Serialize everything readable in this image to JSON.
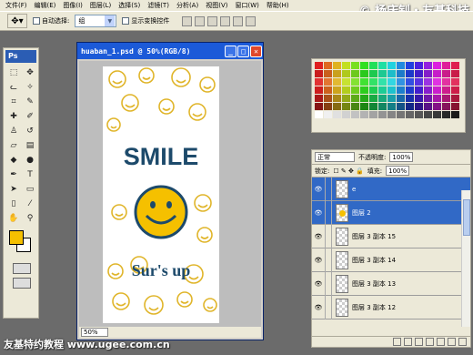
{
  "menu": [
    "文件(F)",
    "编辑(E)",
    "图像(I)",
    "图层(L)",
    "选择(S)",
    "滤镜(T)",
    "分析(A)",
    "视图(V)",
    "窗口(W)",
    "帮助(H)"
  ],
  "watermark_top": "© 杨庆钊・友基科技",
  "watermark_bottom": "友基特约教程 www.ugee.com.cn",
  "options": {
    "auto_select_label": "自动选择:",
    "auto_select_value": "组",
    "show_transform_label": "显示变换控件"
  },
  "document": {
    "title": "huaban_1.psd @ 50%(RGB/8)",
    "zoom": "50%",
    "artwork_text_1": "SMILE",
    "artwork_text_2": "Sur's up"
  },
  "colors": {
    "foreground": "#f5c000",
    "background": "#ffffff",
    "smiley_yellow": "#f5c000",
    "ink_blue": "#1d4a6b",
    "selection_blue": "#3169c6"
  },
  "layers_panel": {
    "blend_mode": "正常",
    "opacity_label": "不透明度:",
    "opacity_value": "100%",
    "lock_label": "锁定:",
    "fill_label": "填充:",
    "fill_value": "100%",
    "layers": [
      {
        "name": "e",
        "selected": true
      },
      {
        "name": "图层 2",
        "selected": true
      },
      {
        "name": "图层 3 副本 15",
        "selected": false
      },
      {
        "name": "图层 3 副本 14",
        "selected": false
      },
      {
        "name": "图层 3 副本 13",
        "selected": false
      },
      {
        "name": "图层 3 副本 12",
        "selected": false
      }
    ]
  }
}
